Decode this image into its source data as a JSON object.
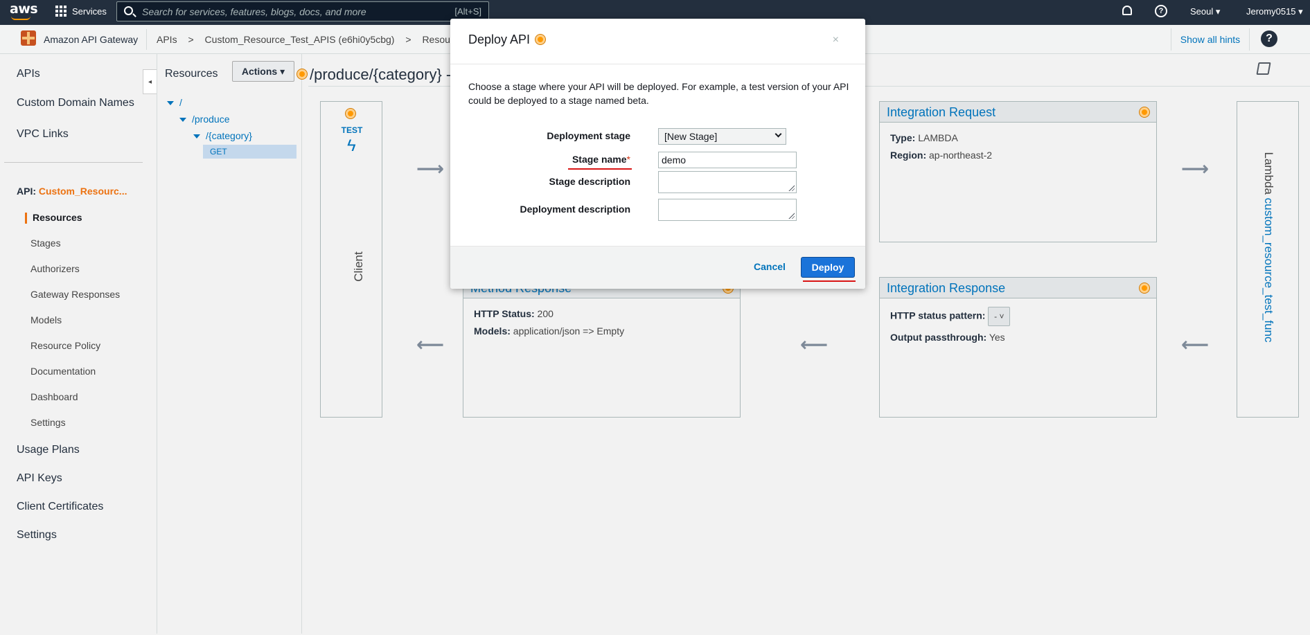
{
  "topnav": {
    "logo_text": "aws",
    "services_label": "Services",
    "search_placeholder": "Search for services, features, blogs, docs, and more",
    "search_shortcut": "[Alt+S]",
    "region": "Seoul ▾",
    "account": "Jeromy0515 ▾"
  },
  "subbar": {
    "product": "Amazon API Gateway",
    "breadcrumbs": [
      "APIs",
      ">",
      "Custom_Resource_Test_APIS (e6hi0y5cbg)",
      ">",
      "Resou"
    ],
    "show_hints": "Show all hints",
    "help": "?"
  },
  "sidebar": {
    "top_items": [
      "APIs",
      "Custom Domain Names",
      "VPC Links"
    ],
    "api_prefix": "API:",
    "api_name": "Custom_Resourc...",
    "sub_items": [
      "Resources",
      "Stages",
      "Authorizers",
      "Gateway Responses",
      "Models",
      "Resource Policy",
      "Documentation",
      "Dashboard",
      "Settings"
    ],
    "bottom_items": [
      "Usage Plans",
      "API Keys",
      "Client Certificates",
      "Settings"
    ],
    "collapse_glyph": "◂"
  },
  "resources": {
    "title": "Resources",
    "actions_label": "Actions ▾",
    "tree": [
      "/",
      "/produce",
      "/{category}"
    ],
    "selected_method": "GET"
  },
  "main": {
    "title": "/produce/{category} -",
    "client": {
      "test_label": "TEST",
      "bolt": "ϟ",
      "label": "Client"
    },
    "integration_request": {
      "title": "Integration Request",
      "type_label": "Type:",
      "type_value": "LAMBDA",
      "region_label": "Region:",
      "region_value": "ap-northeast-2"
    },
    "method_response": {
      "title": "Method Response",
      "status_label": "HTTP Status:",
      "status_value": "200",
      "models_label": "Models:",
      "models_value": "application/json => Empty"
    },
    "integration_response": {
      "title": "Integration Response",
      "pattern_label": "HTTP status pattern:",
      "pattern_value": "-",
      "passthrough_label": "Output passthrough:",
      "passthrough_value": "Yes"
    },
    "lambda": {
      "prefix": "Lambda",
      "function": "custom_resource_test_func"
    },
    "arrow_right": "⟶",
    "arrow_left": "⟵"
  },
  "modal": {
    "title": "Deploy API",
    "close": "×",
    "description": "Choose a stage where your API will be deployed. For example, a test version of your API could be deployed to a stage named beta.",
    "deployment_stage_label": "Deployment stage",
    "deployment_stage_value": "[New Stage]",
    "stage_name_label": "Stage name",
    "stage_name_required": "*",
    "stage_name_value": "demo",
    "stage_description_label": "Stage description",
    "deployment_description_label": "Deployment description",
    "cancel_label": "Cancel",
    "deploy_label": "Deploy"
  },
  "colors": {
    "nav": "#232f3e",
    "accent": "#ec7211",
    "link": "#0073bb",
    "primary_button": "#1a73d9",
    "annotation": "#d91515"
  }
}
